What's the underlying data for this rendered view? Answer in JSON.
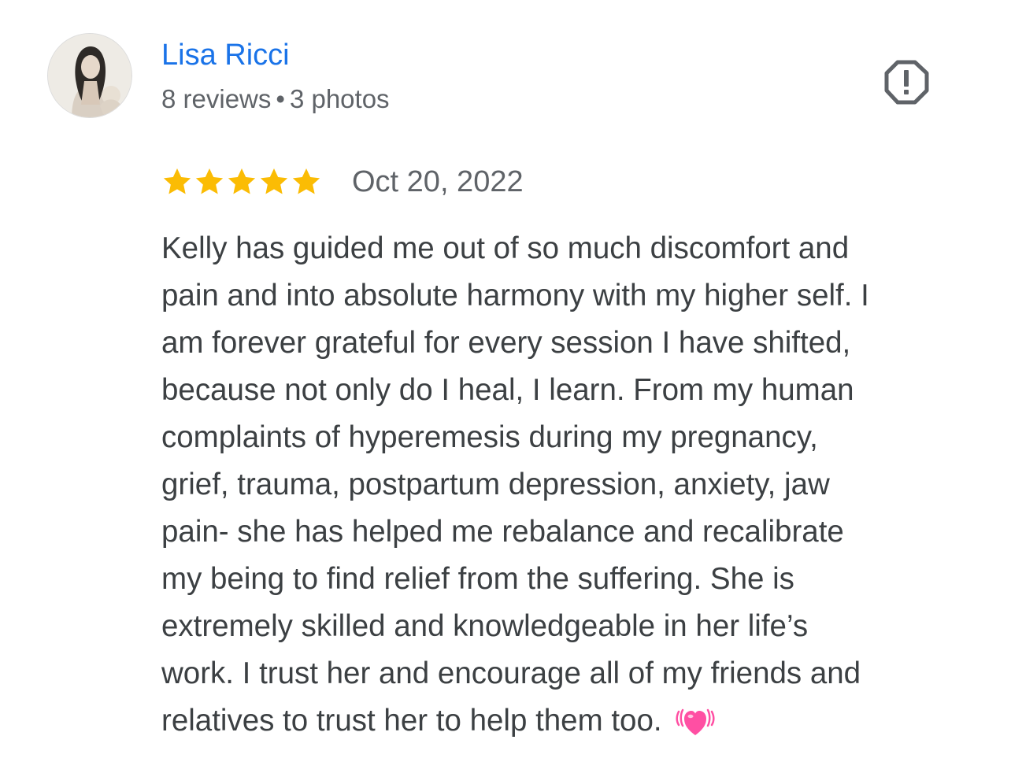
{
  "reviewer": {
    "name": "Lisa Ricci",
    "reviews_count": "8 reviews",
    "separator": "•",
    "photos_count": "3 photos",
    "avatar": "avatar-photo"
  },
  "actions": {
    "report_icon": "report-flag-icon"
  },
  "review": {
    "rating": 5,
    "max_rating": 5,
    "star_color": "#fbbc04",
    "date": "Oct 20, 2022",
    "text": "Kelly has guided me out of so much discomfort and\npain and into absolute harmony with my higher self. I\nam forever grateful for every session I have shifted,\nbecause not only do I heal, I learn. From my human\ncomplaints of hyperemesis during my pregnancy,\ngrief, trauma, postpartum depression, anxiety, jaw\npain- she has helped me rebalance and recalibrate\nmy being to find relief from the suffering. She is\nextremely skilled and knowledgeable in her life’s\nwork. I trust her and encourage all of my friends and\nrelatives to trust her to help them too. ",
    "emoji_icon": "heart-emoji-icon"
  },
  "colors": {
    "name_link": "#1a73e8",
    "secondary_text": "#5f6368",
    "body_text": "#3c4043",
    "icon_gray": "#5f6368",
    "heart_pink": "#ff4fa3"
  }
}
